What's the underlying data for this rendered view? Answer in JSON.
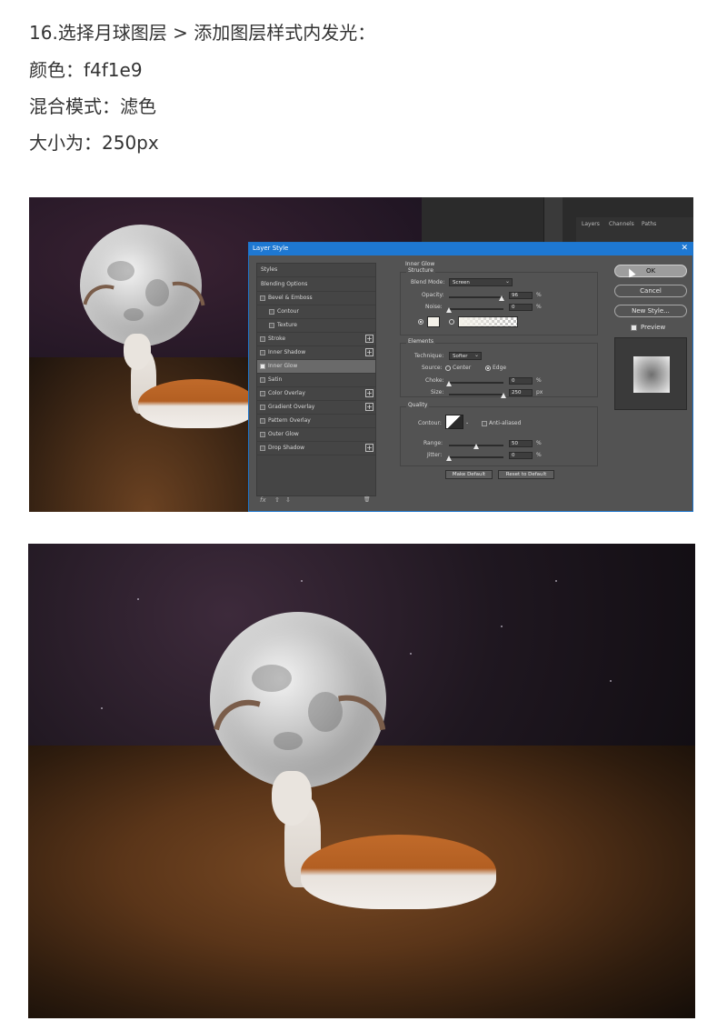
{
  "instructions": {
    "step": "16.选择月球图层 > 添加图层样式内发光：",
    "color": "颜色：f4f1e9",
    "blend": "混合模式：滤色",
    "size": "大小为：250px"
  },
  "photoshop": {
    "panel_tabs": [
      "Layers",
      "Channels",
      "Paths"
    ],
    "dialog": {
      "title": "Layer Style",
      "close": "✕",
      "styles_header": "Styles",
      "style_items": [
        {
          "label": "Blending Options",
          "checkbox": false,
          "plus": false,
          "indent": false,
          "selected": false
        },
        {
          "label": "Bevel & Emboss",
          "checkbox": true,
          "plus": false,
          "indent": false,
          "selected": false
        },
        {
          "label": "Contour",
          "checkbox": true,
          "plus": false,
          "indent": true,
          "selected": false
        },
        {
          "label": "Texture",
          "checkbox": true,
          "plus": false,
          "indent": true,
          "selected": false
        },
        {
          "label": "Stroke",
          "checkbox": true,
          "plus": true,
          "indent": false,
          "selected": false
        },
        {
          "label": "Inner Shadow",
          "checkbox": true,
          "plus": true,
          "indent": false,
          "selected": false
        },
        {
          "label": "Inner Glow",
          "checkbox": true,
          "checked": true,
          "plus": false,
          "indent": false,
          "selected": true
        },
        {
          "label": "Satin",
          "checkbox": true,
          "plus": false,
          "indent": false,
          "selected": false
        },
        {
          "label": "Color Overlay",
          "checkbox": true,
          "plus": true,
          "indent": false,
          "selected": false
        },
        {
          "label": "Gradient Overlay",
          "checkbox": true,
          "plus": true,
          "indent": false,
          "selected": false
        },
        {
          "label": "Pattern Overlay",
          "checkbox": true,
          "plus": false,
          "indent": false,
          "selected": false
        },
        {
          "label": "Outer Glow",
          "checkbox": true,
          "plus": false,
          "indent": false,
          "selected": false
        },
        {
          "label": "Drop Shadow",
          "checkbox": true,
          "plus": true,
          "indent": false,
          "selected": false
        }
      ],
      "fx_bar": {
        "fx": "fx",
        "up": "⇧",
        "down": "⇩",
        "trash": "🗑"
      },
      "inner_glow": {
        "title": "Inner Glow",
        "structure_title": "Structure",
        "blend_mode_label": "Blend Mode:",
        "blend_mode_value": "Screen",
        "opacity_label": "Opacity:",
        "opacity_value": "96",
        "opacity_fraction": 0.96,
        "noise_label": "Noise:",
        "noise_value": "0",
        "noise_fraction": 0.0,
        "percent": "%",
        "glow_color": "#f4f1e9",
        "elements_title": "Elements",
        "technique_label": "Technique:",
        "technique_value": "Softer",
        "source_label": "Source:",
        "source_center": "Center",
        "source_edge": "Edge",
        "choke_label": "Choke:",
        "choke_value": "0",
        "choke_fraction": 0.0,
        "size_label": "Size:",
        "size_value": "250",
        "size_fraction": 1.0,
        "px": "px",
        "quality_title": "Quality",
        "contour_label": "Contour:",
        "anti_aliased_label": "Anti-aliased",
        "range_label": "Range:",
        "range_value": "50",
        "range_fraction": 0.5,
        "jitter_label": "Jitter:",
        "jitter_value": "0",
        "jitter_fraction": 0.0,
        "make_default": "Make Default",
        "reset_default": "Reset to Default"
      },
      "buttons": {
        "ok": "OK",
        "cancel": "Cancel",
        "new_style": "New Style...",
        "preview": "Preview"
      }
    }
  }
}
